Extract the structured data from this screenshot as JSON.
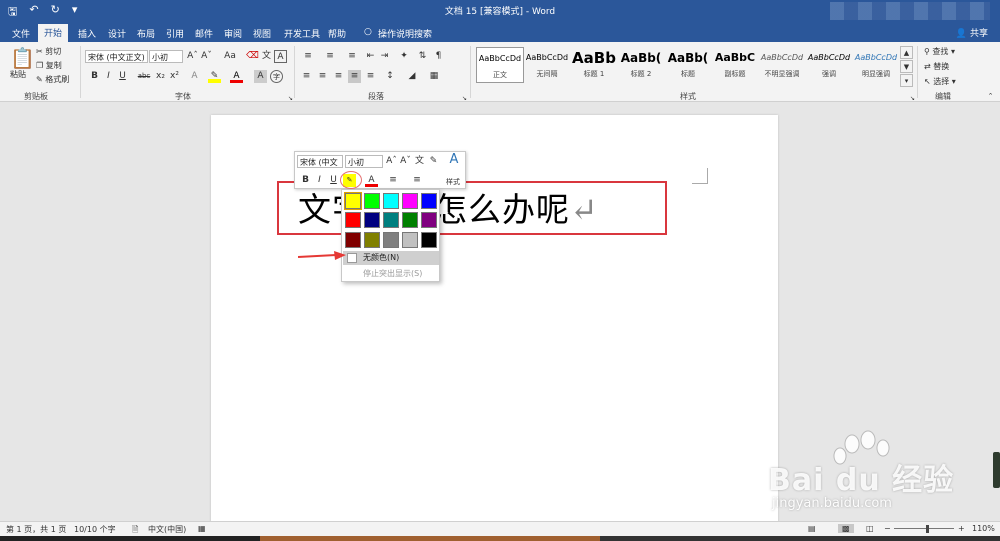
{
  "window": {
    "title": "文档 15 [兼容模式] - Word",
    "share_label": "共享"
  },
  "quick_access": [
    "save-icon",
    "undo-icon",
    "redo-icon",
    "customize-icon"
  ],
  "tabs": [
    "文件",
    "开始",
    "插入",
    "设计",
    "布局",
    "引用",
    "邮件",
    "审阅",
    "视图",
    "开发工具",
    "帮助",
    "操作说明搜索"
  ],
  "active_tab": "开始",
  "ribbon": {
    "clipboard": {
      "label": "剪贴板",
      "paste": "粘贴",
      "cut": "剪切",
      "copy": "复制",
      "format_painter": "格式刷"
    },
    "font": {
      "label": "字体",
      "font_name": "宋体 (中文正文)",
      "font_size": "小初"
    },
    "paragraph": {
      "label": "段落"
    },
    "styles": {
      "label": "样式",
      "items": [
        {
          "sample": "AaBbCcDd",
          "name": "正文"
        },
        {
          "sample": "AaBbCcDd",
          "name": "无间隔"
        },
        {
          "sample": "AaBb",
          "name": "标题 1"
        },
        {
          "sample": "AaBb(",
          "name": "标题 2"
        },
        {
          "sample": "AaBb(",
          "name": "标题"
        },
        {
          "sample": "AaBbC",
          "name": "副标题"
        },
        {
          "sample": "AaBbCcDd",
          "name": "不明显强调"
        },
        {
          "sample": "AaBbCcDd",
          "name": "强调"
        },
        {
          "sample": "AaBbCcDd",
          "name": "明显强调"
        }
      ]
    },
    "editing": {
      "label": "编辑",
      "find": "查找",
      "replace": "替换",
      "select": "选择"
    }
  },
  "document": {
    "text": "文字底色怎么办呢",
    "mark": "↵"
  },
  "mini_toolbar": {
    "font_name": "宋体 (中文",
    "font_size": "小初",
    "styles_label": "样式"
  },
  "highlight_palette": {
    "colors": [
      "#ffff00",
      "#00ff00",
      "#00ffff",
      "#ff00ff",
      "#0000ff",
      "#ff0000",
      "#000080",
      "#008080",
      "#008000",
      "#800080",
      "#800000",
      "#808000",
      "#808080",
      "#c0c0c0",
      "#000000"
    ],
    "no_color": "无颜色(N)",
    "stop_highlight": "停止突出显示(S)"
  },
  "status": {
    "page": "第 1 页，共 1 页",
    "words": "10/10 个字",
    "language": "中文(中国)",
    "zoom": "110%"
  },
  "watermark": {
    "brand": "Bai du 经验",
    "url": "jingyan.baidu.com"
  }
}
